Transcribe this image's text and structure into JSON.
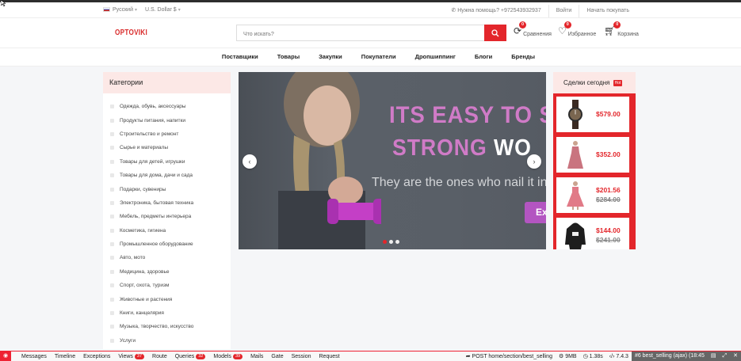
{
  "topbar": {
    "language": "Русский",
    "currency": "U.S. Dollar $",
    "help": "Нужна помощь? +972543932937",
    "login": "Войти",
    "start_selling": "Начать покупать"
  },
  "header": {
    "logo": "OPTOVIKI",
    "search_placeholder": "Что искать?",
    "compare": {
      "label": "Сравнения",
      "count": "0"
    },
    "wishlist": {
      "label": "Избранное",
      "count": "0"
    },
    "cart": {
      "label": "Корзина",
      "count": "0"
    }
  },
  "nav": [
    "Поставщики",
    "Товары",
    "Закупки",
    "Покупатели",
    "Дропшиппинг",
    "Блоги",
    "Бренды"
  ],
  "categories": {
    "title": "Категории",
    "items": [
      "Одежда, обувь, аксессуары",
      "Продукты питания, напитки",
      "Строительство и ремонт",
      "Сырье и материалы",
      "Товары для детей, игрушки",
      "Товары для дома, дачи и сада",
      "Подарки, сувениры",
      "Электроника, бытовая техника",
      "Мебель, предметы интерьера",
      "Косметика, гигиена",
      "Промышленное оборудование",
      "Авто, мото",
      "Медицина, здоровье",
      "Спорт, охота, туризм",
      "Животные и растения",
      "Книги, канцелярия",
      "Музыка, творчество, искусство",
      "Услуги"
    ]
  },
  "slider": {
    "line1": "ITS EASY TO S",
    "line2_color": "STRONG ",
    "line2_white": "WO",
    "line3": "They are the ones who nail it in",
    "cta": "Ex",
    "active_slide": 1,
    "total_slides": 3
  },
  "deals": {
    "title": "Сделки сегодня",
    "hot": "Hot",
    "items": [
      {
        "price": "$579.00",
        "old": "",
        "image": "watch-icon"
      },
      {
        "price": "$352.00",
        "old": "",
        "image": "dress-icon"
      },
      {
        "price": "$201.56",
        "old": "$284.00",
        "image": "dress-icon"
      },
      {
        "price": "$144.00",
        "old": "$241.00",
        "image": "hoodie-icon"
      }
    ]
  },
  "debugbar": {
    "tabs": [
      {
        "label": "Messages",
        "count": ""
      },
      {
        "label": "Timeline",
        "count": ""
      },
      {
        "label": "Exceptions",
        "count": ""
      },
      {
        "label": "Views",
        "count": "37"
      },
      {
        "label": "Route",
        "count": ""
      },
      {
        "label": "Queries",
        "count": "32"
      },
      {
        "label": "Models",
        "count": "39"
      },
      {
        "label": "Mails",
        "count": ""
      },
      {
        "label": "Gate",
        "count": ""
      },
      {
        "label": "Session",
        "count": ""
      },
      {
        "label": "Request",
        "count": ""
      }
    ],
    "route": "POST home/section/best_selling",
    "memory": "9MB",
    "time": "1.38s",
    "php": "7.4.3",
    "request": "#6 best_selling (ajax) (18:45"
  }
}
